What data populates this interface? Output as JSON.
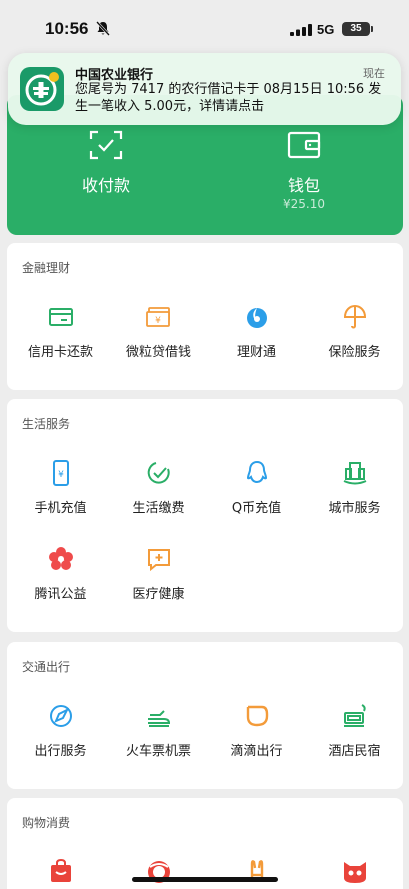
{
  "status_bar": {
    "time": "10:56",
    "network": "5G",
    "battery": "35"
  },
  "notification": {
    "app": "中国农业银行",
    "time": "现在",
    "body": "您尾号为 7417 的农行借记卡于 08月15日 10:56 发生一笔收入 5.00元，详情请点击"
  },
  "header": {
    "receive_label": "收付款",
    "wallet_label": "钱包",
    "wallet_balance": "¥25.10",
    "accent_color": "#2aae67"
  },
  "sections": [
    {
      "title": "金融理财",
      "items": [
        {
          "label": "信用卡还款",
          "icon": "credit-card-icon"
        },
        {
          "label": "微粒贷借钱",
          "icon": "loan-icon"
        },
        {
          "label": "理财通",
          "icon": "wealth-icon"
        },
        {
          "label": "保险服务",
          "icon": "insurance-icon"
        }
      ]
    },
    {
      "title": "生活服务",
      "items": [
        {
          "label": "手机充值",
          "icon": "phone-recharge-icon"
        },
        {
          "label": "生活缴费",
          "icon": "utility-payment-icon"
        },
        {
          "label": "Q币充值",
          "icon": "qq-coin-icon"
        },
        {
          "label": "城市服务",
          "icon": "city-service-icon"
        },
        {
          "label": "腾讯公益",
          "icon": "charity-icon"
        },
        {
          "label": "医疗健康",
          "icon": "medical-icon"
        }
      ]
    },
    {
      "title": "交通出行",
      "items": [
        {
          "label": "出行服务",
          "icon": "travel-icon"
        },
        {
          "label": "火车票机票",
          "icon": "train-flight-icon"
        },
        {
          "label": "滴滴出行",
          "icon": "didi-icon"
        },
        {
          "label": "酒店民宿",
          "icon": "hotel-icon"
        }
      ]
    },
    {
      "title": "购物消费",
      "items": [
        {
          "label": "",
          "icon": "shopping-bag-icon"
        },
        {
          "label": "",
          "icon": "food-delivery-icon"
        },
        {
          "label": "",
          "icon": "rabbit-icon"
        },
        {
          "label": "",
          "icon": "cat-icon"
        }
      ]
    }
  ]
}
